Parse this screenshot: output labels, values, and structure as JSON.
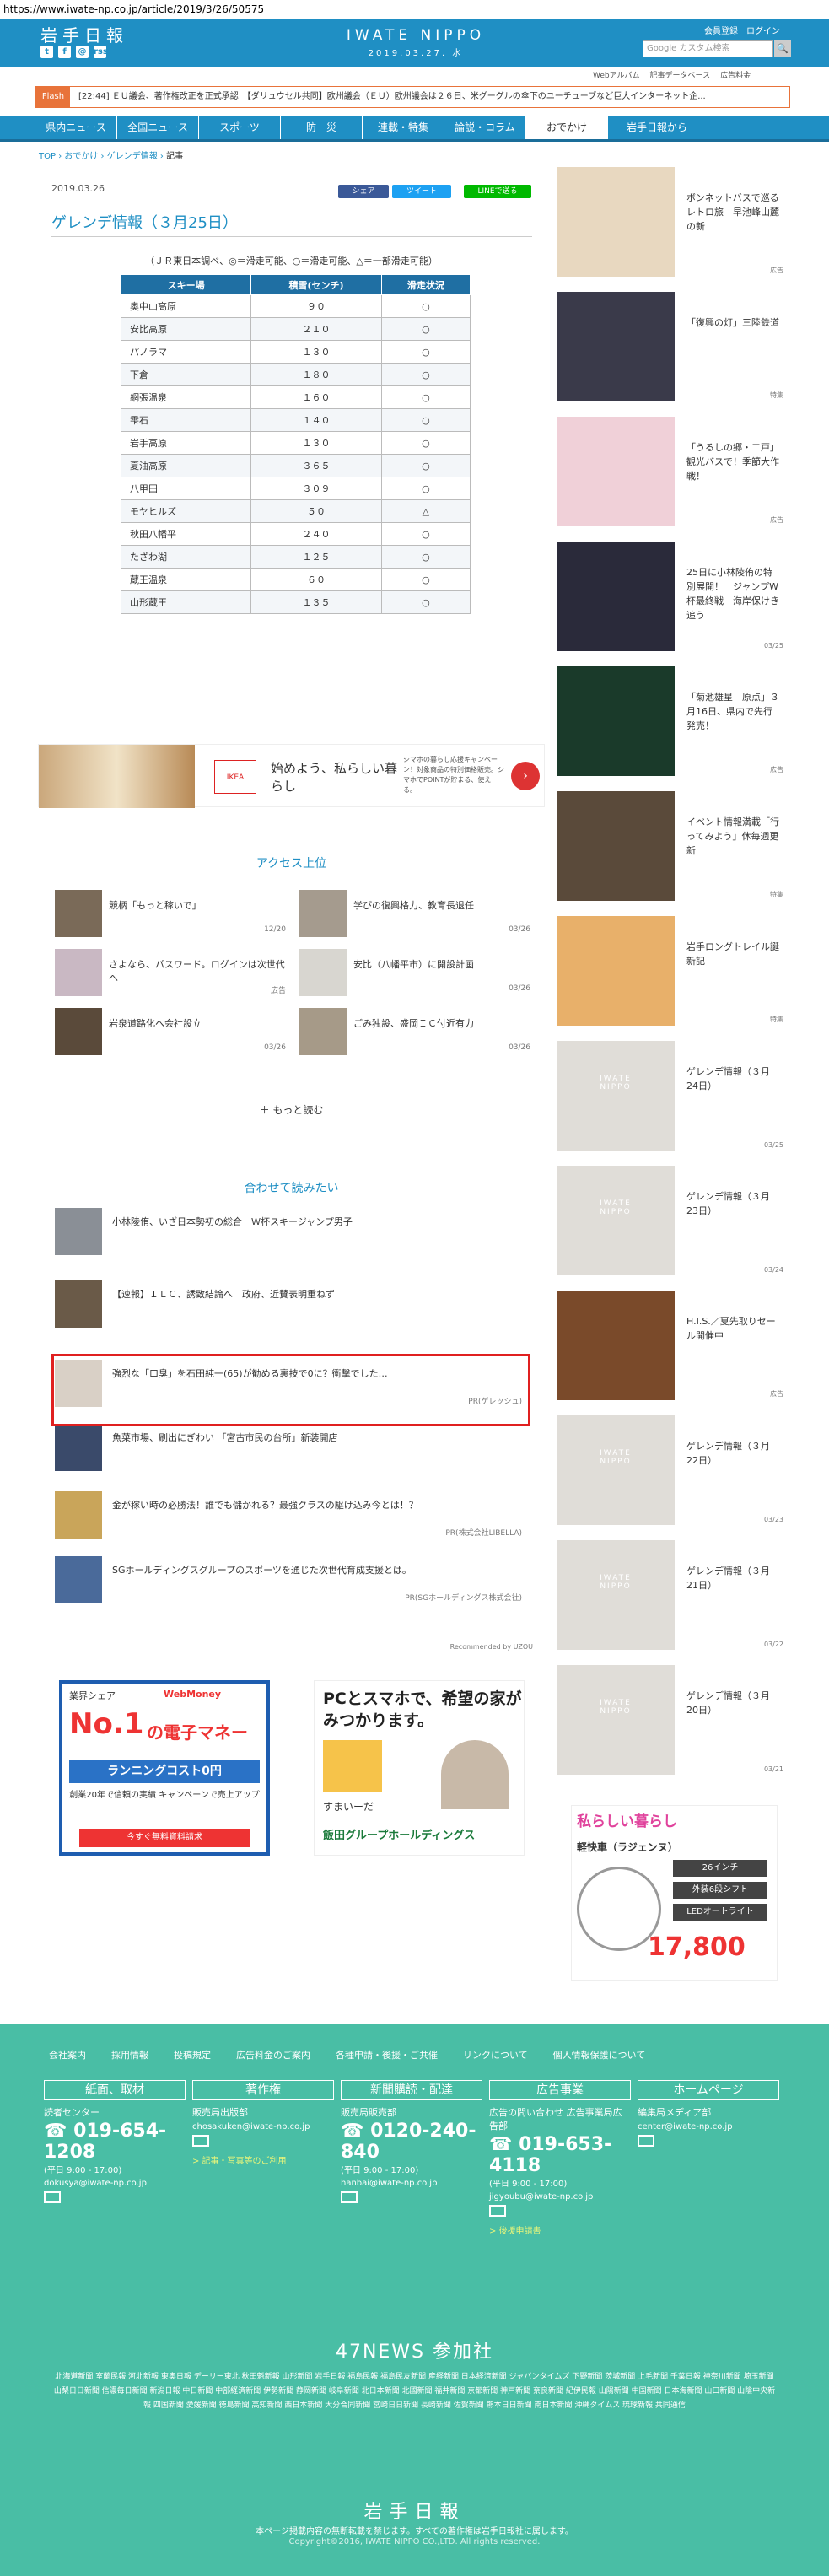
{
  "url": "https://www.iwate-np.co.jp/article/2019/3/26/50575",
  "header": {
    "logo": "岩手日報",
    "brand": "IWATE NIPPO",
    "date": "2019.03.27. 水",
    "member_link": "会員登録",
    "login_link": "ログイン",
    "search_placeholder": "Google カスタム検索",
    "search_button": "🔍",
    "social": [
      "t",
      "f",
      "@",
      "rss"
    ]
  },
  "subnav": [
    "Webアルバム",
    "記事データベース",
    "広告料金"
  ],
  "flash": {
    "tag": "Flash",
    "text": "[22:44] ＥＵ議会、著作権改正を正式承認　【ダリュウセル共同】欧州議会（ＥＵ）欧州議会は２６日、米グーグルの傘下のユーチューブなど巨大インターネット企..."
  },
  "gnav": [
    "県内ニュース",
    "全国ニュース",
    "スポーツ",
    "防　災",
    "連載・特集",
    "論説・コラム",
    "おでかけ",
    "岩手日報から"
  ],
  "breadcrumb": [
    "TOP",
    "おでかけ",
    "ゲレンデ情報",
    "記事"
  ],
  "article": {
    "date": "2019.03.26",
    "share": [
      "シェア",
      "ツイート",
      "LINEで送る"
    ],
    "title": "ゲレンデ情報（３月25日）",
    "note": "（ＪＲ東日本調べ、◎＝滑走可能、○＝滑走可能、△＝一部滑走可能）",
    "headers": [
      "スキー場",
      "積雪(センチ)",
      "滑走状況"
    ],
    "rows": [
      [
        "奥中山高原",
        "９０",
        "○"
      ],
      [
        "安比高原",
        "２１０",
        "○"
      ],
      [
        "パノラマ",
        "１３０",
        "○"
      ],
      [
        "下倉",
        "１８０",
        "○"
      ],
      [
        "網張温泉",
        "１６０",
        "○"
      ],
      [
        "雫石",
        "１４０",
        "○"
      ],
      [
        "岩手高原",
        "１３０",
        "○"
      ],
      [
        "夏油高原",
        "３６５",
        "○"
      ],
      [
        "八甲田",
        "３０９",
        "○"
      ],
      [
        "モヤヒルズ",
        "５０",
        "△"
      ],
      [
        "秋田八幡平",
        "２４０",
        "○"
      ],
      [
        "たざわ湖",
        "１２５",
        "○"
      ],
      [
        "蔵王温泉",
        "６０",
        "○"
      ],
      [
        "山形蔵王",
        "１３５",
        "○"
      ]
    ]
  },
  "ad1": {
    "brand": "IKEA",
    "headline": "始めよう、私らしい暮らし",
    "desc": "シマホの暮らし応援キャンペーン！対象商品の特別価格販売。シマホでPOINTが貯まる、使える。"
  },
  "access": {
    "title": "アクセス上位",
    "items": [
      {
        "t": "競柄「もっと稼いで」",
        "d": "12/20"
      },
      {
        "t": "学びの復興格力、教育長退任",
        "d": "03/26"
      },
      {
        "t": "さよなら、パスワード。ログインは次世代へ",
        "d": "広告"
      },
      {
        "t": "安比（八幡平市）に開設計画",
        "d": "03/26"
      },
      {
        "t": "岩泉道路化へ会社設立",
        "d": "03/26"
      },
      {
        "t": "ごみ独設、盛岡ＩＣ付近有力",
        "d": "03/26"
      }
    ],
    "more": "もっと読む"
  },
  "together": {
    "title": "合わせて読みたい",
    "items": [
      {
        "t": "小林陵侑、いざ日本勢初の総合　Ｗ杯スキージャンプ男子",
        "pr": ""
      },
      {
        "t": "【速報】ＩＬＣ、誘致結論へ　政府、近賛表明重ねず",
        "pr": ""
      },
      {
        "t": "強烈な「口臭」を石田純一(65)が勧める裏技で0に？衝撃でした…",
        "pr": "PR(ゲレッシュ)"
      },
      {
        "t": "魚菜市場、刷出にぎわい 「宮古市民の台所」新装開店",
        "pr": ""
      },
      {
        "t": "金が稼い時の必勝法！誰でも儲かれる？最強クラスの駆け込み今とは！？",
        "pr": "PR(株式会社LIBELLA)"
      },
      {
        "t": "SGホールディングスグループのスポーツを通じた次世代育成支援とは。",
        "pr": "PR(SGホールディングス株式会社)"
      }
    ],
    "recommended": "Recommended by UZOU"
  },
  "ad2": {
    "brand": "WebMoney",
    "top": "業界シェア",
    "no1": "No.1",
    "emoney": "の電子マネー",
    "bar": "ランニングコスト0円",
    "small": "創業20年で信頼の実績 キャンペーンで売上アップ",
    "btn": "今すぐ無料資料請求"
  },
  "ad3": {
    "headline": "PCとスマホで、希望の家がみつかります。",
    "sub": "すまいーだ",
    "footer": "飯田グループホールディングス"
  },
  "sidebar": [
    {
      "t": "ボンネットバスで巡るレトロ旅　早池峰山麓の新",
      "d": "広告"
    },
    {
      "t": "「復興の灯」三陸鉄道",
      "d": "特集"
    },
    {
      "t": "「うるしの郷・二戸」観光バスで！季節大作戦！",
      "d": "広告"
    },
    {
      "t": "25日に小林陵侑の特別展開！　ジャンプW杯最終戦　海岸保けき追う",
      "d": "03/25"
    },
    {
      "t": "「菊池雄星　原点」３月16日、県内で先行発売！",
      "d": "広告"
    },
    {
      "t": "イベント情報満載「行ってみよう」休毎週更新",
      "d": "特集"
    },
    {
      "t": "岩手ロングトレイル誕新記",
      "d": "特集"
    },
    {
      "t": "ゲレンデ情報（３月24日）",
      "d": "03/25"
    },
    {
      "t": "ゲレンデ情報（３月23日）",
      "d": "03/24"
    },
    {
      "t": "H.I.S.／夏先取りセール開催中",
      "d": "広告"
    },
    {
      "t": "ゲレンデ情報（３月22日）",
      "d": "03/23"
    },
    {
      "t": "ゲレンデ情報（３月21日）",
      "d": "03/22"
    },
    {
      "t": "ゲレンデ情報（３月20日）",
      "d": "03/21"
    }
  ],
  "ad4": {
    "headline": "私らしい暮らし",
    "labels": [
      "26インチ",
      "外装6段シフト",
      "LEDオートライト"
    ],
    "price": "17,800",
    "sub": "軽快車（ラジェンヌ）"
  },
  "footer": {
    "links": [
      "会社案内",
      "採用情報",
      "投稿規定",
      "広告料金のご案内",
      "各種申請・後援・ご共催",
      "リンクについて",
      "個人情報保護について"
    ],
    "cols": [
      {
        "title": "紙面、取材",
        "l1": "読者センター",
        "tel": "019-654-1208",
        "hr": "(平日 9:00 - 17:00)",
        "mail": "dokusya@iwate-np.co.jp",
        "sub": ""
      },
      {
        "title": "著作権",
        "l1": "販売局出版部",
        "tel": "",
        "hr": "",
        "mail": "chosakuken@iwate-np.co.jp",
        "sub": "> 記事・写真等のご利用"
      },
      {
        "title": "新聞購読・配達",
        "l1": "販売局販売部",
        "tel": "0120-240-840",
        "hr": "(平日 9:00 - 17:00)",
        "mail": "hanbai@iwate-np.co.jp",
        "sub": ""
      },
      {
        "title": "広告事業",
        "l1": "広告の問い合わせ 広告事業局広告部",
        "tel": "019-653-4118",
        "hr": "(平日 9:00 - 17:00)",
        "mail": "jigyoubu@iwate-np.co.jp",
        "sub": "> 後援申請書"
      },
      {
        "title": "ホームページ",
        "l1": "編集局メディア部",
        "tel": "",
        "hr": "",
        "mail": "center@iwate-np.co.jp",
        "sub": ""
      }
    ],
    "n47": "47NEWS 参加社",
    "papers": "北海道新聞 室蘭民報 河北新報 東奥日報 デーリー東北 秋田魁新報 山形新聞 岩手日報 福島民報 福島民友新聞 産経新聞 日本経済新聞 ジャパンタイムズ 下野新聞 茨城新聞 上毛新聞 千葉日報 神奈川新聞 埼玉新聞 山梨日日新聞 信濃毎日新聞 新潟日報 中日新聞 中部経済新聞 伊勢新聞 静岡新聞 岐阜新聞 北日本新聞 北國新聞 福井新聞 京都新聞 神戸新聞 奈良新聞 紀伊民報 山陽新聞 中国新聞 日本海新聞 山口新聞 山陰中央新報 四国新聞 愛媛新聞 徳島新聞 高知新聞 西日本新聞 大分合同新聞 宮崎日日新聞 長崎新聞 佐賀新聞 熊本日日新聞 南日本新聞 沖縄タイムス 琉球新報 共同通信",
    "logo": "岩手日報",
    "copy1": "本ページ掲載内容の無断転載を禁じます。すべての著作権は岩手日報社に属します。",
    "copy2": "Copyright©2016, IWATE NIPPO CO.,LTD. All rights reserved."
  }
}
